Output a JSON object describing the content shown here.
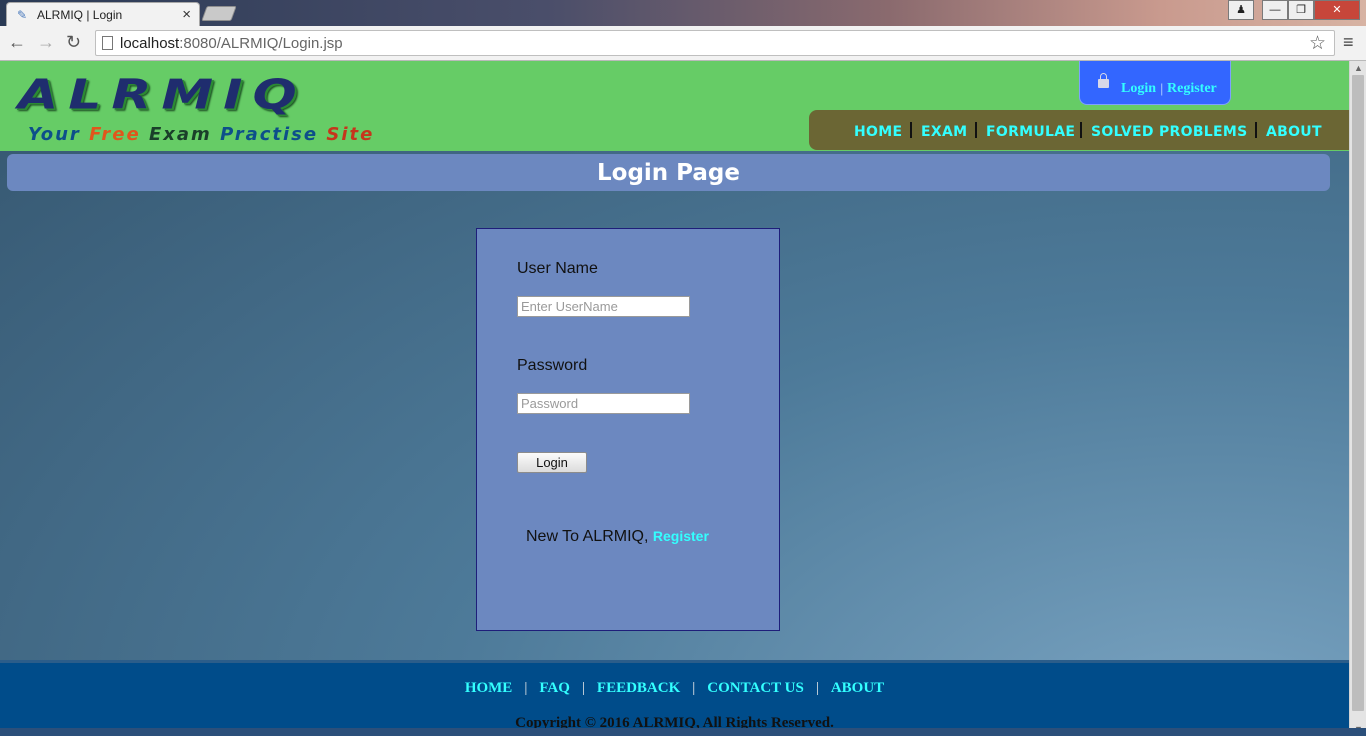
{
  "browser": {
    "tab_title": "ALRMIQ | Login",
    "tab_close": "×",
    "url_host": "localhost",
    "url_path": ":8080/ALRMIQ/Login.jsp",
    "back_glyph": "←",
    "forward_glyph": "→",
    "reload_glyph": "↻",
    "star_glyph": "☆",
    "menu_glyph": "≡",
    "win_user": "♟",
    "win_min": "—",
    "win_max": "❐",
    "win_close": "✕"
  },
  "site": {
    "logo_text": "ALRMIQ",
    "tagline": [
      "Your",
      "Free",
      "Exam",
      "Practise",
      "Site"
    ]
  },
  "auth": {
    "login": "Login",
    "separator": "|",
    "register": "Register"
  },
  "topnav": {
    "items": [
      "HOME",
      "EXAM",
      "FORMULAE",
      "SOLVED PROBLEMS",
      "ABOUT"
    ]
  },
  "page": {
    "title": "Login Page"
  },
  "form": {
    "username_label": "User Name",
    "username_placeholder": "Enter UserName",
    "password_label": "Password",
    "password_placeholder": "Password",
    "login_button": "Login",
    "new_to_text": "New To ALRMIQ,",
    "register_link": "Register"
  },
  "footer": {
    "links": [
      "HOME",
      "FAQ",
      "FEEDBACK",
      "CONTACT US",
      "ABOUT"
    ],
    "separator": "|",
    "copyright": "Copyright © 2016 ALRMIQ, All Rights Reserved."
  }
}
